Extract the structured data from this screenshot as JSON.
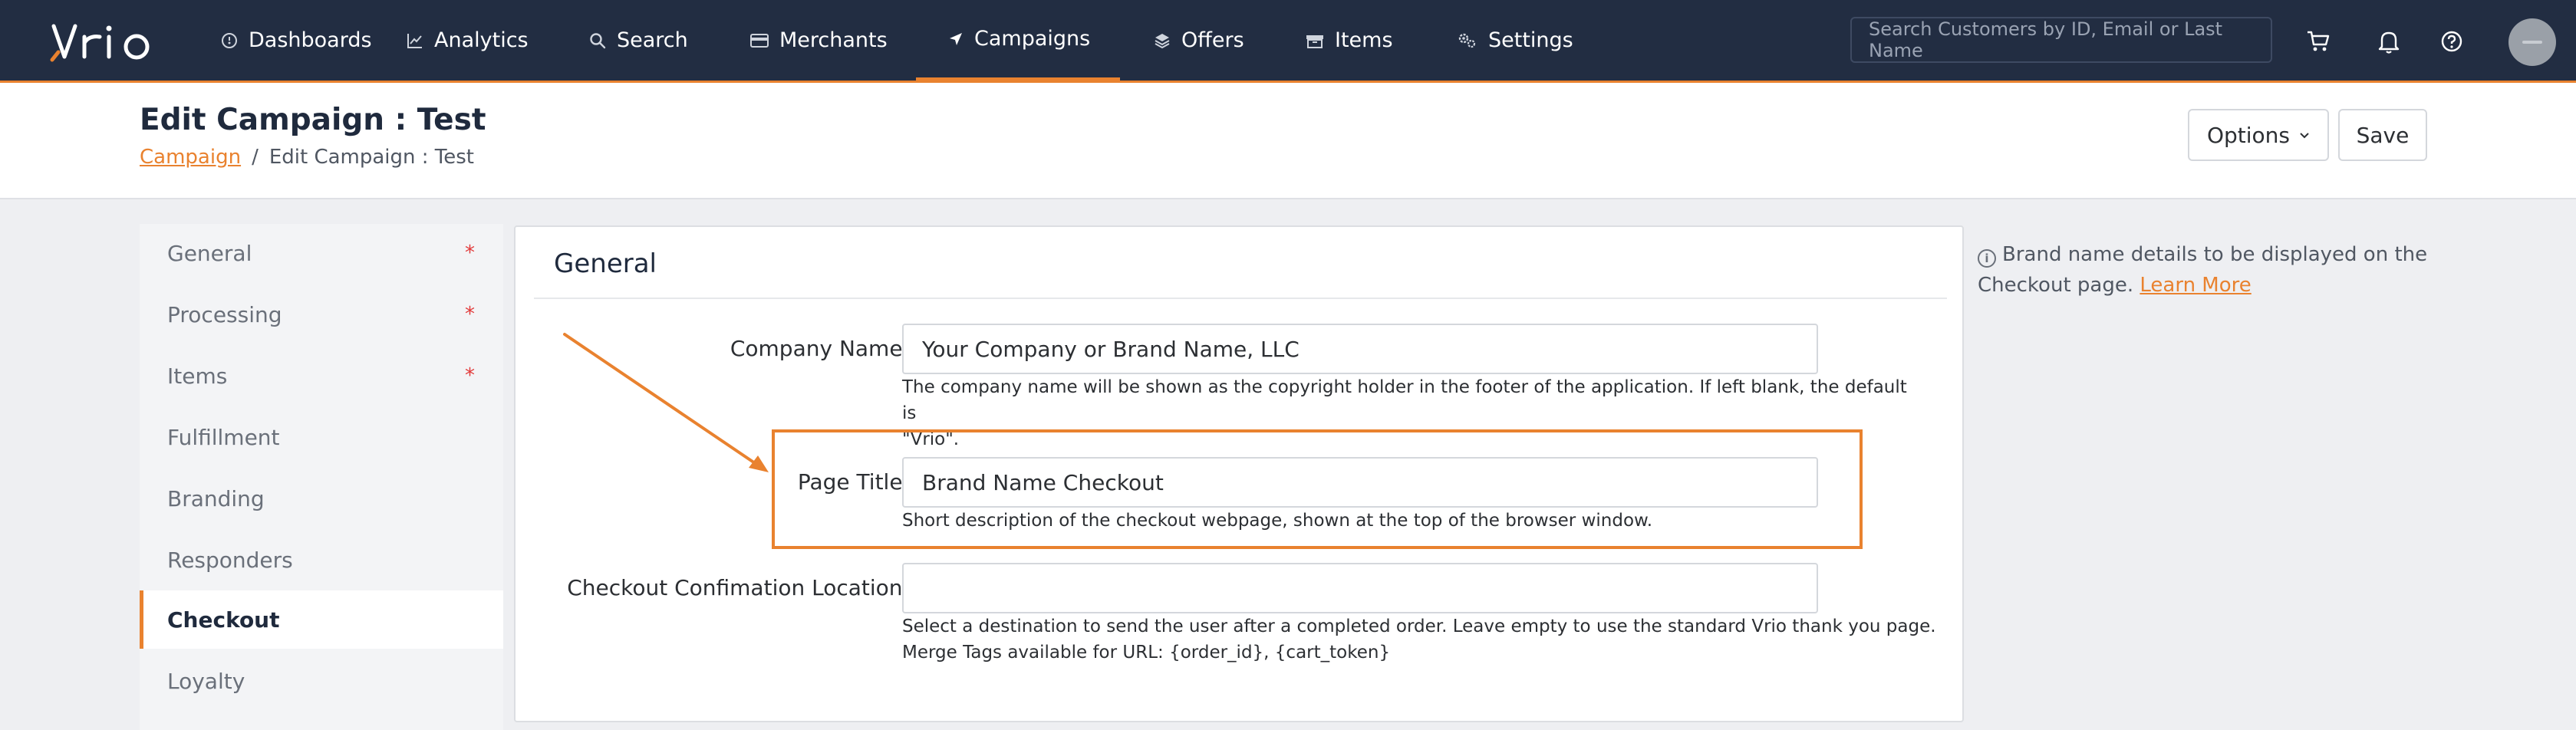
{
  "app": {
    "logo": "Vrio"
  },
  "nav": {
    "items": [
      {
        "label": "Dashboards",
        "icon": "dashboard-icon"
      },
      {
        "label": "Analytics",
        "icon": "chart-icon"
      },
      {
        "label": "Search",
        "icon": "search-icon"
      },
      {
        "label": "Merchants",
        "icon": "card-icon"
      },
      {
        "label": "Campaigns",
        "icon": "send-icon",
        "active": true
      },
      {
        "label": "Offers",
        "icon": "layers-icon"
      },
      {
        "label": "Items",
        "icon": "box-icon"
      },
      {
        "label": "Settings",
        "icon": "gear-icon"
      }
    ],
    "search_placeholder": "Search Customers by ID, Email or Last Name"
  },
  "header": {
    "title": "Edit Campaign : Test",
    "breadcrumb": {
      "link": "Campaign",
      "separator": "/",
      "current": "Edit Campaign : Test"
    },
    "options_label": "Options",
    "save_label": "Save"
  },
  "sidebar": {
    "items": [
      {
        "label": "General",
        "required": "*"
      },
      {
        "label": "Processing",
        "required": "*"
      },
      {
        "label": "Items",
        "required": "*"
      },
      {
        "label": "Fulfillment"
      },
      {
        "label": "Branding"
      },
      {
        "label": "Responders"
      },
      {
        "label": "Checkout",
        "active": true
      },
      {
        "label": "Loyalty"
      }
    ]
  },
  "card": {
    "title": "General",
    "company_name": {
      "label": "Company Name:",
      "value": "Your Company or Brand Name, LLC",
      "help_line1": "The company name will be shown as the copyright holder in the footer of the application. If left blank, the default is",
      "help_line2": "\"Vrio\"."
    },
    "page_title": {
      "label": "Page Title:",
      "value": "Brand Name Checkout",
      "help": "Short description of the checkout webpage, shown at the top of the browser window."
    },
    "confirmation": {
      "label": "Checkout Confimation Location:",
      "value": "",
      "help_line1": "Select a destination to send the user after a completed order. Leave empty to use the standard Vrio thank you page.",
      "help_line2": "Merge Tags available for URL: {order_id}, {cart_token}"
    }
  },
  "info": {
    "text": "Brand name details to be displayed on the Checkout page.",
    "link": "Learn More"
  },
  "colors": {
    "accent": "#e9822f",
    "nav_bg": "#222d42"
  }
}
